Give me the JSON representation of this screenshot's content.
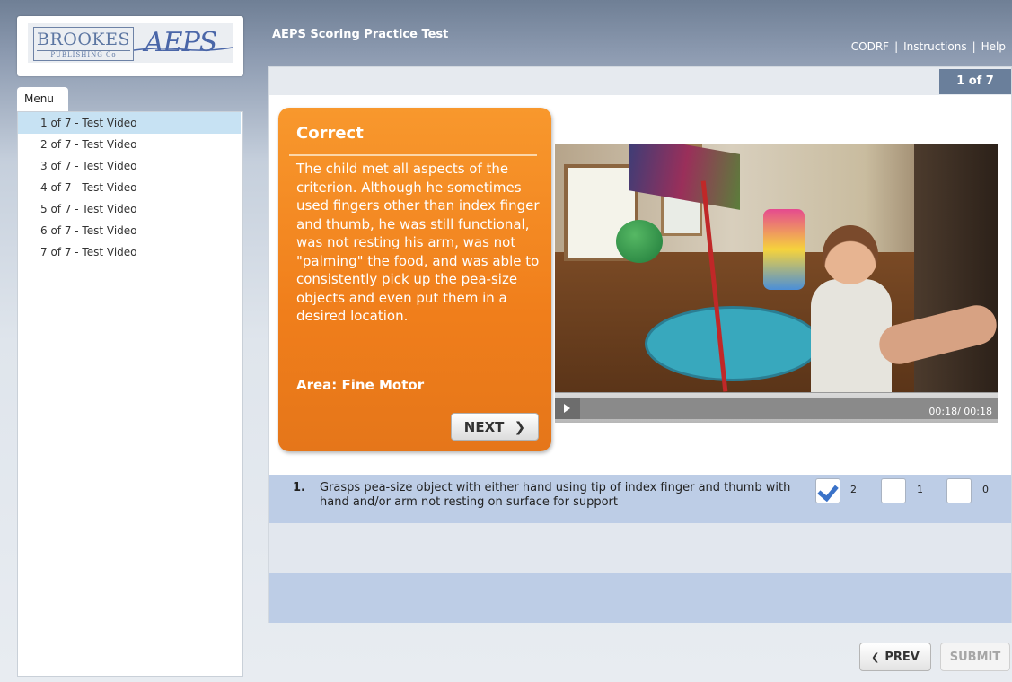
{
  "logo": {
    "publisher_big": "BROOKES",
    "publisher_small": "PUBLISHING Co",
    "product": "AEPS"
  },
  "header": {
    "title": "AEPS Scoring Practice Test",
    "links": [
      "CODRF",
      "Instructions",
      "Help"
    ],
    "separator": "|"
  },
  "sidebar": {
    "tab_label": "Menu",
    "items": [
      {
        "label": "1 of 7 - Test Video",
        "active": true
      },
      {
        "label": "2 of 7 - Test Video"
      },
      {
        "label": "3 of 7 - Test Video"
      },
      {
        "label": "4 of 7 - Test Video"
      },
      {
        "label": "5 of 7 - Test Video"
      },
      {
        "label": "6 of 7 - Test Video"
      },
      {
        "label": "7 of 7 - Test Video"
      }
    ]
  },
  "main": {
    "counter": "1 of 7",
    "feedback": {
      "title": "Correct",
      "body": "The child met all aspects of the criterion. Although he sometimes used fingers other than index finger and thumb, he was still functional, was not resting his arm, was not \"palming\" the food, and was able to consistently pick up the pea-size objects and even put them in a desired location.",
      "area": "Area: Fine Motor",
      "next_label": "NEXT"
    },
    "video": {
      "time": "00:18/ 00:18"
    },
    "question": {
      "number": "1.",
      "text": "Grasps pea-size object with either hand using tip of index finger and thumb with hand and/or arm not resting on surface for support",
      "options": [
        {
          "label": "2",
          "checked": true
        },
        {
          "label": "1",
          "checked": false
        },
        {
          "label": "0",
          "checked": false
        }
      ]
    }
  },
  "footer": {
    "prev_label": "PREV",
    "submit_label": "SUBMIT"
  },
  "colors": {
    "feedback_orange": "#f08a22",
    "counter_bg": "#6a7f9b",
    "question_row": "#bdcde6",
    "check_blue": "#3a72c8",
    "active_menu": "#c7e2f3"
  }
}
